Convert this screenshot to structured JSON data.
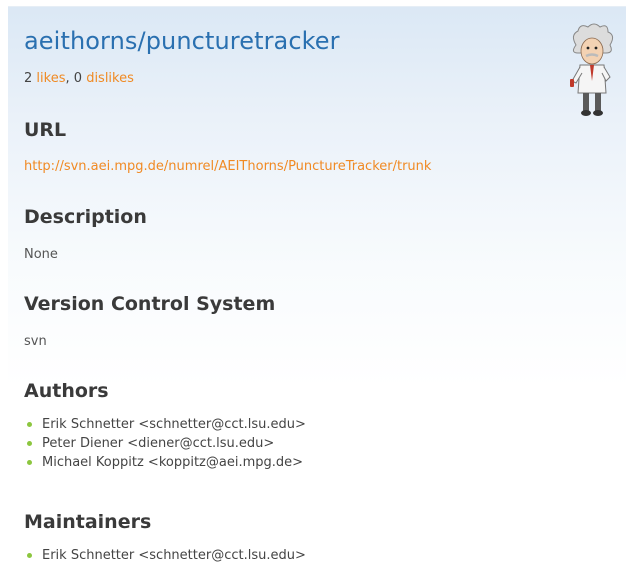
{
  "repo": {
    "title": "aeithorns/puncturetracker",
    "likes_count": "2",
    "likes_label": "likes",
    "separator": ",",
    "dislikes_count": "0",
    "dislikes_label": "dislikes"
  },
  "sections": {
    "url": {
      "heading": "URL",
      "value": "http://svn.aei.mpg.de/numrel/AEIThorns/PunctureTracker/trunk"
    },
    "description": {
      "heading": "Description",
      "value": "None"
    },
    "vcs": {
      "heading": "Version Control System",
      "value": "svn"
    },
    "authors": {
      "heading": "Authors",
      "items": [
        "Erik Schnetter <schnetter@cct.lsu.edu>",
        "Peter Diener <diener@cct.lsu.edu>",
        "Michael Koppitz <koppitz@aei.mpg.de>"
      ]
    },
    "maintainers": {
      "heading": "Maintainers",
      "items": [
        "Erik Schnetter <schnetter@cct.lsu.edu>"
      ]
    }
  },
  "icons": {
    "mascot": "einstein-mascot-icon",
    "bullet": "green-bullet-icon"
  },
  "colors": {
    "title": "#2a70b0",
    "link": "#f08a24",
    "bullet": "#8cc63f",
    "heading": "#3a3a3a"
  }
}
